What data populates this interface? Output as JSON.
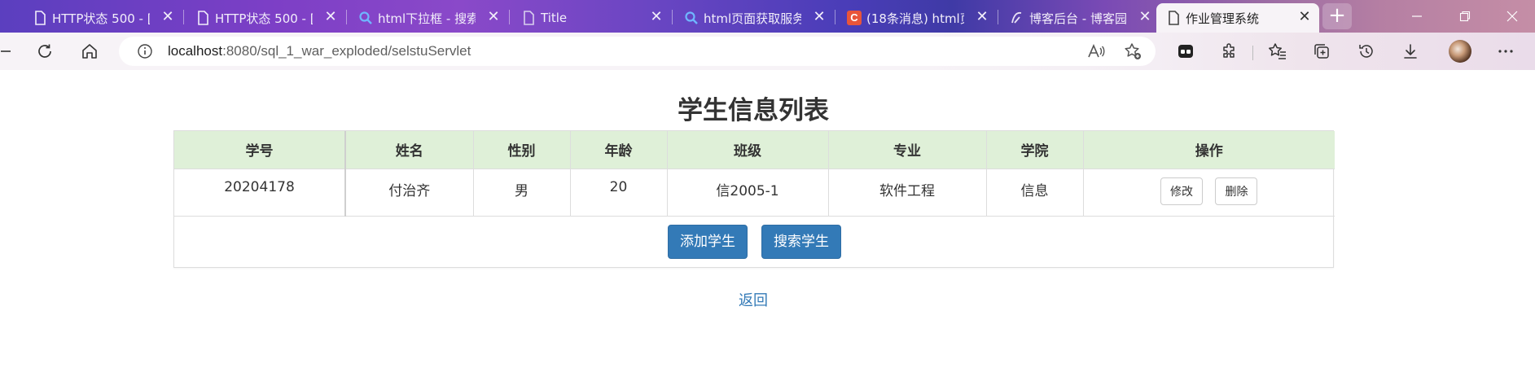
{
  "browser": {
    "tabs": [
      {
        "title": "HTTP状态 500 - [",
        "icon": "document-icon"
      },
      {
        "title": "HTTP状态 500 - [",
        "icon": "document-icon"
      },
      {
        "title": "html下拉框 - 搜索",
        "icon": "search-icon"
      },
      {
        "title": "Title",
        "icon": "document-icon"
      },
      {
        "title": "html页面获取服务",
        "icon": "search-icon"
      },
      {
        "title": "(18条消息) html页",
        "icon": "csdn-logo-icon"
      },
      {
        "title": "博客后台 - 博客园",
        "icon": "cnblogs-logo-icon"
      },
      {
        "title": "作业管理系统",
        "icon": "document-icon",
        "active": true
      }
    ],
    "url_host": "localhost",
    "url_rest": ":8080/sql_1_war_exploded/selstuServlet"
  },
  "page": {
    "title": "学生信息列表",
    "columns": [
      "学号",
      "姓名",
      "性别",
      "年龄",
      "班级",
      "专业",
      "学院",
      "操作"
    ],
    "rows": [
      {
        "id": "20204178",
        "name": "付治齐",
        "gender": "男",
        "age": "20",
        "class": "信2005-1",
        "major": "软件工程",
        "college": "信息",
        "edit": "修改",
        "delete": "删除"
      }
    ],
    "add_button": "添加学生",
    "search_button": "搜索学生",
    "back_link": "返回"
  },
  "colors": {
    "header_bg": "#dff0d8",
    "primary": "#337ab7",
    "link": "#337ab7"
  }
}
